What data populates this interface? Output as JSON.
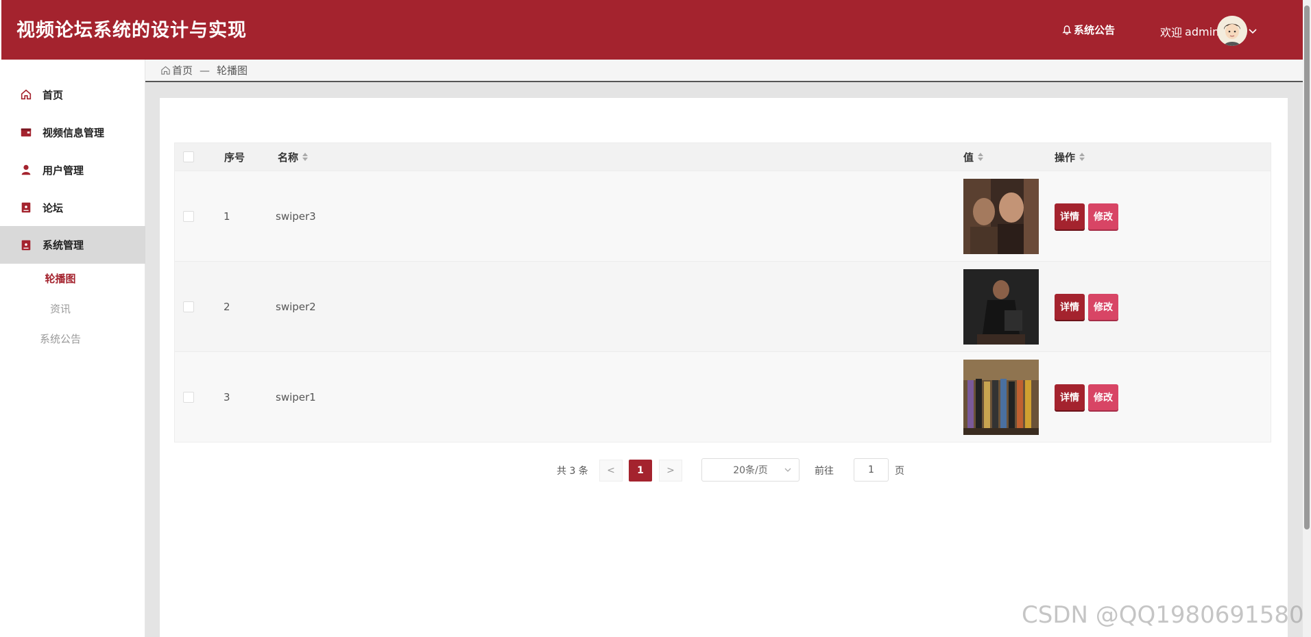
{
  "header": {
    "title": "视频论坛系统的设计与实现",
    "notice_label": "系统公告",
    "welcome_text": "欢迎",
    "username": "admin"
  },
  "breadcrumb": {
    "home": "首页",
    "separator": "—",
    "current": "轮播图"
  },
  "sidebar": {
    "items": [
      {
        "label": "首页",
        "icon": "home-icon"
      },
      {
        "label": "视频信息管理",
        "icon": "folder-icon"
      },
      {
        "label": "用户管理",
        "icon": "user-icon"
      },
      {
        "label": "论坛",
        "icon": "book-icon"
      },
      {
        "label": "系统管理",
        "icon": "book-icon"
      }
    ],
    "submenu": [
      {
        "label": "轮播图"
      },
      {
        "label": "资讯"
      },
      {
        "label": "系统公告"
      }
    ]
  },
  "table": {
    "columns": {
      "index": "序号",
      "name": "名称",
      "value": "值",
      "actions": "操作"
    },
    "rows": [
      {
        "index": "1",
        "name": "swiper3",
        "detail": "详情",
        "edit": "修改"
      },
      {
        "index": "2",
        "name": "swiper2",
        "detail": "详情",
        "edit": "修改"
      },
      {
        "index": "3",
        "name": "swiper1",
        "detail": "详情",
        "edit": "修改"
      }
    ]
  },
  "pagination": {
    "total_text": "共 3 条",
    "prev": "<",
    "next": ">",
    "current_page": "1",
    "page_size": "20条/页",
    "goto_label": "前往",
    "goto_value": "1",
    "page_suffix": "页"
  },
  "watermark": "CSDN @QQ1980691580",
  "colors": {
    "brand": "#a4232e",
    "edit_button": "#d84565"
  }
}
